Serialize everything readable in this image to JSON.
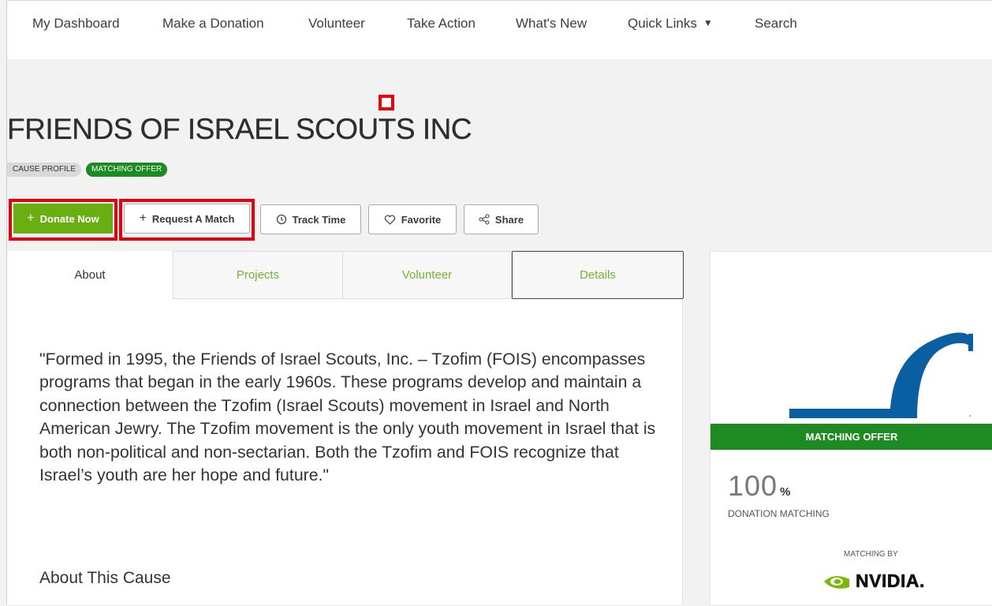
{
  "nav": {
    "items": [
      "My Dashboard",
      "Make a Donation",
      "Volunteer",
      "Take Action",
      "What's New",
      "Quick Links",
      "Search"
    ]
  },
  "page": {
    "title": "FRIENDS OF ISRAEL SCOUTS INC",
    "badges": [
      "CAUSE PROFILE",
      "MATCHING OFFER"
    ]
  },
  "actions": {
    "donate": "Donate Now",
    "request_match": "Request A Match",
    "track_time": "Track Time",
    "favorite": "Favorite",
    "share": "Share"
  },
  "tabs": [
    "About",
    "Projects",
    "Volunteer",
    "Details"
  ],
  "about": {
    "quote": "\"Formed in 1995, the Friends of Israel Scouts, Inc. – Tzofim (FOIS) encompasses programs that began in the early 1960s. These programs develop and maintain a connection between the Tzofim (Israel Scouts) movement in Israel and North American Jewry. The Tzofim movement is the only youth movement in Israel that is both non-political and non-sectarian. Both the Tzofim and FOIS recognize that Israel’s youth are her hope and future.\"",
    "heading": "About This Cause"
  },
  "matching_card": {
    "banner": "MATCHING OFFER",
    "percent": "100",
    "percent_sign": "%",
    "percent_label": "DONATION MATCHING",
    "matching_by_label": "MATCHING BY",
    "sponsor": "NVIDIA."
  },
  "colors": {
    "accent_green": "#6aaf11",
    "match_green": "#1e8a22",
    "highlight_red": "#e3000f",
    "logo_blue": "#0a5fa3"
  }
}
